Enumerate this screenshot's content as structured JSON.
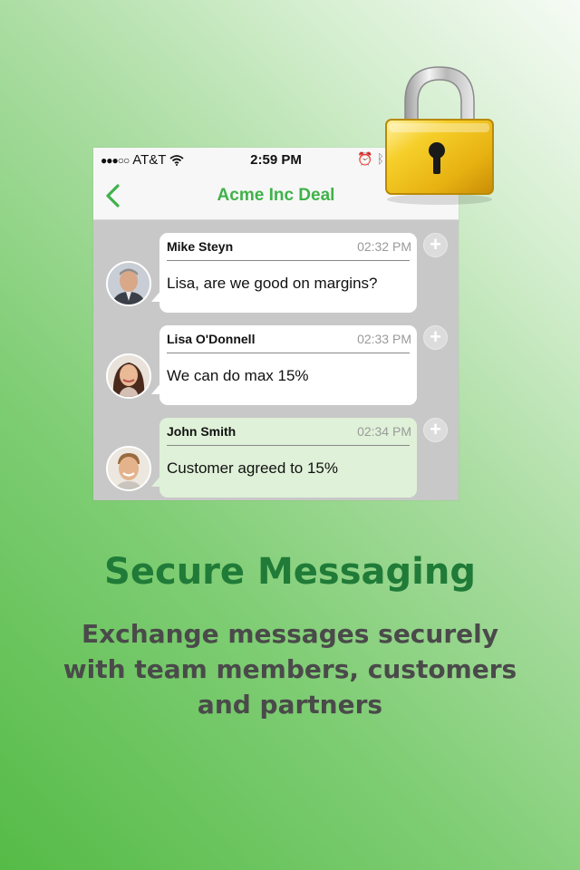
{
  "statusbar": {
    "carrier": "AT&T",
    "time": "2:59 PM"
  },
  "header": {
    "title": "Acme Inc Deal"
  },
  "messages": [
    {
      "sender": "Mike Steyn",
      "time": "02:32 PM",
      "text": "Lisa, are we good on margins?"
    },
    {
      "sender": "Lisa O'Donnell",
      "time": "02:33 PM",
      "text": "We can do max 15%"
    },
    {
      "sender": "John Smith",
      "time": "02:34 PM",
      "text": "Customer agreed to 15%"
    }
  ],
  "promo": {
    "headline": "Secure Messaging",
    "line1": "Exchange messages securely",
    "line2": "with team members, customers",
    "line3": "and partners"
  },
  "colors": {
    "accent": "#3fb24a",
    "headline": "#1f7b37",
    "own_bubble": "#dff1d8",
    "lock_gold": "#f2c21a"
  },
  "icons": {
    "back": "chevron-left-icon",
    "wifi": "wifi-icon",
    "alarm": "alarm-icon",
    "bluetooth": "bluetooth-icon",
    "add": "plus-icon",
    "lock": "padlock-icon"
  }
}
